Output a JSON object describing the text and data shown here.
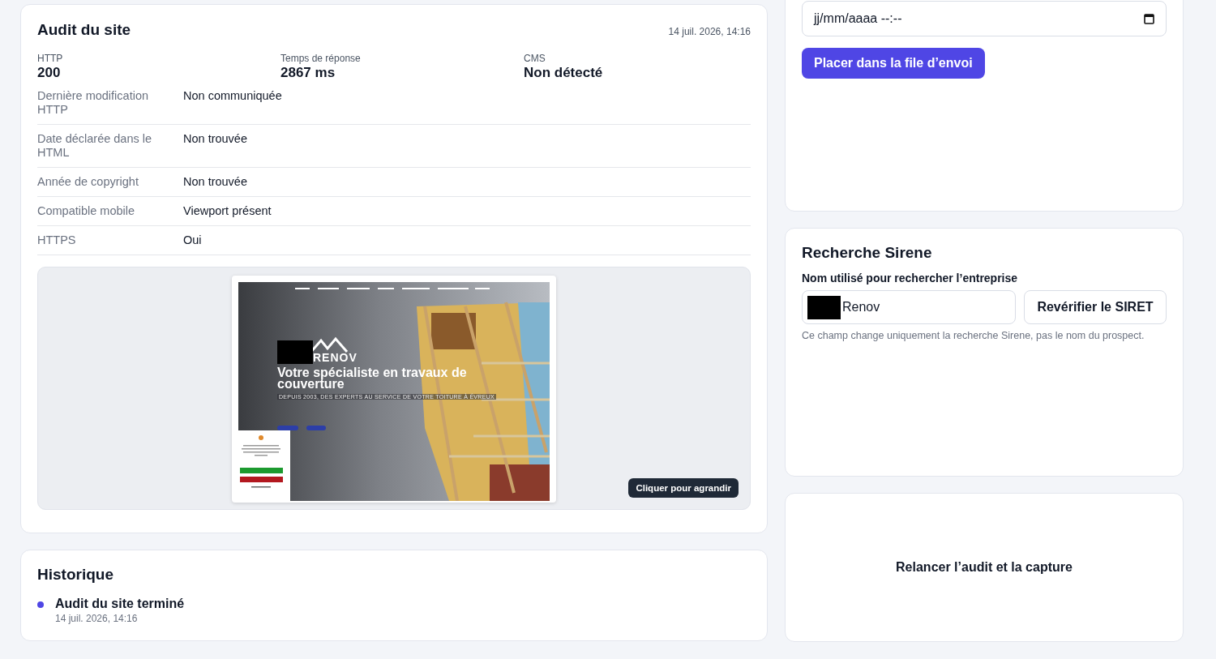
{
  "audit": {
    "title": "Audit du site",
    "date": "14 juil. 2026, 14:16",
    "metrics": [
      {
        "label": "HTTP",
        "value": "200"
      },
      {
        "label": "Temps de réponse",
        "value": "2867 ms"
      },
      {
        "label": "CMS",
        "value": "Non détecté"
      }
    ],
    "details": [
      {
        "label": "Dernière modification HTTP",
        "value": "Non communiquée"
      },
      {
        "label": "Date déclarée dans le HTML",
        "value": "Non trouvée"
      },
      {
        "label": "Année de copyright",
        "value": "Non trouvée"
      },
      {
        "label": "Compatible mobile",
        "value": "Viewport présent"
      },
      {
        "label": "HTTPS",
        "value": "Oui"
      }
    ],
    "preview": {
      "brand": "RENOV",
      "headline": "Votre spécialiste en travaux de couverture",
      "tagline": "DEPUIS 2003, DES EXPERTS AU SERVICE DE VOTRE TOITURE À ÉVREUX",
      "zoom_button": "Cliquer pour agrandir"
    }
  },
  "history": {
    "title": "Historique",
    "events": [
      {
        "title": "Audit du site terminé",
        "time": "14 juil. 2026, 14:16"
      }
    ]
  },
  "schedule": {
    "placeholder": "jj/mm/aaaa --:--",
    "submit": "Placer dans la file d’envoi"
  },
  "sirene": {
    "title": "Recherche Sirene",
    "field_label": "Nom utilisé pour rechercher l’entreprise",
    "value": "Renov",
    "button": "Revérifier le SIRET",
    "hint": "Ce champ change uniquement la recherche Sirene, pas le nom du prospect."
  },
  "relaunch": {
    "label": "Relancer l’audit et la capture"
  }
}
